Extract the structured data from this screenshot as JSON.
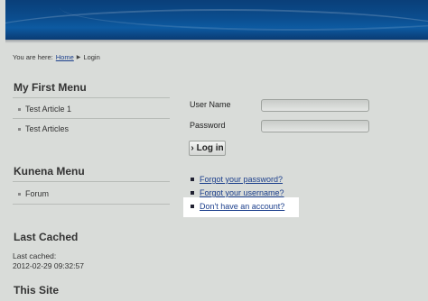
{
  "breadcrumb": {
    "prefix": "You are here:",
    "home": "Home",
    "current": "Login"
  },
  "sidebar": {
    "menu1": {
      "title": "My First Menu",
      "items": [
        "Test Article 1",
        "Test Articles"
      ]
    },
    "menu2": {
      "title": "Kunena Menu",
      "items": [
        "Forum"
      ]
    },
    "cached": {
      "title": "Last Cached",
      "label": "Last cached:",
      "value": "2012-02-29 09:32:57"
    },
    "site": {
      "title": "This Site"
    }
  },
  "login": {
    "username_label": "User Name",
    "password_label": "Password",
    "username_value": "",
    "password_value": "",
    "button_label": "Log in",
    "links": [
      "Forgot your password?",
      "Forgot your username?",
      "Don't have an account?"
    ]
  }
}
